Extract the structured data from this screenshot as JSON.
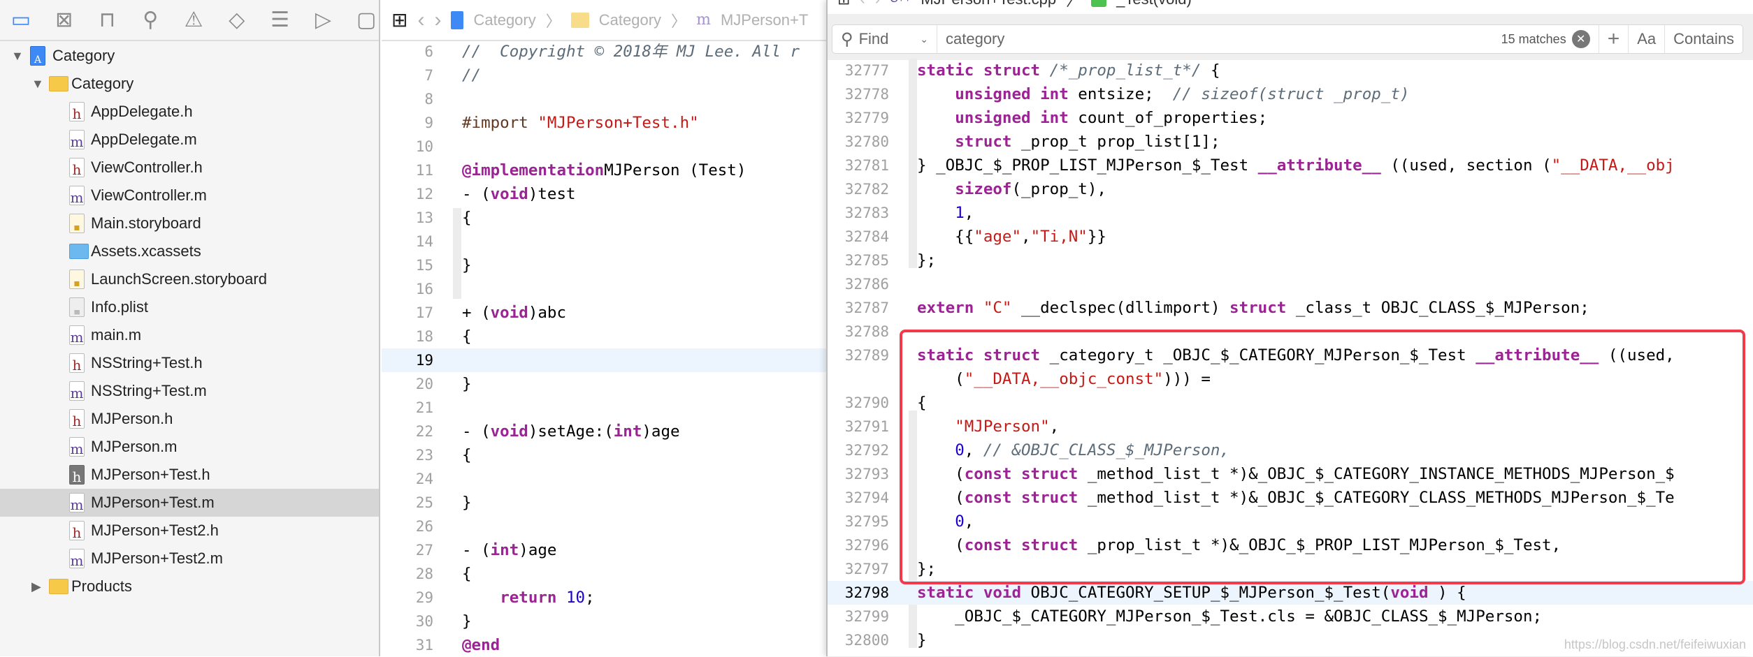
{
  "colors": {
    "accent": "#3d8af7",
    "keyword": "#9b2393",
    "string": "#c41a16",
    "comment": "#5d6c79",
    "number": "#1c00cf",
    "preprocessor": "#643820",
    "highlight_box": "#f23a4a"
  },
  "navigator_icons": [
    "folder-icon",
    "source-control-icon",
    "hierarchy-icon",
    "search-icon",
    "warning-icon",
    "test-icon",
    "debug-icon",
    "breakpoint-icon",
    "report-icon"
  ],
  "tree": [
    {
      "label": "Category",
      "icon": "project",
      "level": 0,
      "expanded": true
    },
    {
      "label": "Category",
      "icon": "folder",
      "level": 1,
      "expanded": true
    },
    {
      "label": "AppDelegate.h",
      "icon": "h",
      "level": 2
    },
    {
      "label": "AppDelegate.m",
      "icon": "m",
      "level": 2
    },
    {
      "label": "ViewController.h",
      "icon": "h",
      "level": 2
    },
    {
      "label": "ViewController.m",
      "icon": "m",
      "level": 2
    },
    {
      "label": "Main.storyboard",
      "icon": "storyboard",
      "level": 2
    },
    {
      "label": "Assets.xcassets",
      "icon": "bluefolder",
      "level": 2
    },
    {
      "label": "LaunchScreen.storyboard",
      "icon": "storyboard",
      "level": 2
    },
    {
      "label": "Info.plist",
      "icon": "plist",
      "level": 2
    },
    {
      "label": "main.m",
      "icon": "m",
      "level": 2
    },
    {
      "label": "NSString+Test.h",
      "icon": "h",
      "level": 2
    },
    {
      "label": "NSString+Test.m",
      "icon": "m",
      "level": 2
    },
    {
      "label": "MJPerson.h",
      "icon": "h",
      "level": 2
    },
    {
      "label": "MJPerson.m",
      "icon": "m",
      "level": 2
    },
    {
      "label": "MJPerson+Test.h",
      "icon": "hdark",
      "level": 2
    },
    {
      "label": "MJPerson+Test.m",
      "icon": "m",
      "level": 2,
      "selected": true
    },
    {
      "label": "MJPerson+Test2.h",
      "icon": "h",
      "level": 2
    },
    {
      "label": "MJPerson+Test2.m",
      "icon": "m",
      "level": 2
    },
    {
      "label": "Products",
      "icon": "folder",
      "level": 1,
      "expanded": false
    }
  ],
  "left_editor": {
    "breadcrumb": [
      "Category",
      "Category",
      "MJPerson+T"
    ],
    "current_line": 19,
    "lines": [
      {
        "n": "6",
        "t": [
          [
            "com",
            "//  Copyright © 2018年 MJ Lee. All r"
          ]
        ]
      },
      {
        "n": "7",
        "t": [
          [
            "com",
            "//"
          ]
        ]
      },
      {
        "n": "8",
        "t": []
      },
      {
        "n": "9",
        "t": [
          [
            "pp",
            "#import "
          ],
          [
            "str",
            "\"MJPerson+Test.h\""
          ]
        ]
      },
      {
        "n": "10",
        "t": []
      },
      {
        "n": "11",
        "t": [
          [
            "kw",
            "@implementation"
          ],
          [
            "",
            "MJPerson (Test)"
          ]
        ]
      },
      {
        "n": "12",
        "t": [
          [
            "",
            "- ("
          ],
          [
            "kw",
            "void"
          ],
          [
            "",
            ")test"
          ]
        ]
      },
      {
        "n": "13",
        "t": [
          [
            "",
            "{"
          ]
        ]
      },
      {
        "n": "14",
        "t": []
      },
      {
        "n": "15",
        "t": [
          [
            "",
            "}"
          ]
        ]
      },
      {
        "n": "16",
        "t": []
      },
      {
        "n": "17",
        "t": [
          [
            "",
            "+ ("
          ],
          [
            "kw",
            "void"
          ],
          [
            "",
            ")abc"
          ]
        ]
      },
      {
        "n": "18",
        "t": [
          [
            "",
            "{"
          ]
        ]
      },
      {
        "n": "19",
        "t": []
      },
      {
        "n": "20",
        "t": [
          [
            "",
            "}"
          ]
        ]
      },
      {
        "n": "21",
        "t": []
      },
      {
        "n": "22",
        "t": [
          [
            "",
            "- ("
          ],
          [
            "kw",
            "void"
          ],
          [
            "",
            ")setAge:("
          ],
          [
            "kw",
            "int"
          ],
          [
            "",
            ")age"
          ]
        ]
      },
      {
        "n": "23",
        "t": [
          [
            "",
            "{"
          ]
        ]
      },
      {
        "n": "24",
        "t": []
      },
      {
        "n": "25",
        "t": [
          [
            "",
            "}"
          ]
        ]
      },
      {
        "n": "26",
        "t": []
      },
      {
        "n": "27",
        "t": [
          [
            "",
            "- ("
          ],
          [
            "kw",
            "int"
          ],
          [
            "",
            ")age"
          ]
        ]
      },
      {
        "n": "28",
        "t": [
          [
            "",
            "{"
          ]
        ]
      },
      {
        "n": "29",
        "t": [
          [
            "",
            "    "
          ],
          [
            "kw",
            "return"
          ],
          [
            "num",
            " 10"
          ],
          [
            "",
            ";"
          ]
        ]
      },
      {
        "n": "30",
        "t": [
          [
            "",
            "}"
          ]
        ]
      },
      {
        "n": "31",
        "t": [
          [
            "kw",
            "@end"
          ]
        ]
      }
    ]
  },
  "right_editor": {
    "breadcrumb": [
      "MJPerson+Test.cpp",
      "_Test(void)"
    ],
    "find": {
      "mode": "Find",
      "query": "category",
      "matches": "15 matches",
      "case_label": "Aa",
      "match_type": "Contains"
    },
    "current_line": "32798",
    "lines": [
      {
        "n": "32777",
        "t": [
          [
            "kw",
            "static struct "
          ],
          [
            "com",
            "/*_prop_list_t*/"
          ],
          [
            "",
            " {"
          ]
        ]
      },
      {
        "n": "32778",
        "t": [
          [
            "",
            "    "
          ],
          [
            "kw",
            "unsigned int"
          ],
          [
            "",
            " entsize;  "
          ],
          [
            "com",
            "// sizeof(struct _prop_t)"
          ]
        ]
      },
      {
        "n": "32779",
        "t": [
          [
            "",
            "    "
          ],
          [
            "kw",
            "unsigned int"
          ],
          [
            "",
            " count_of_properties;"
          ]
        ]
      },
      {
        "n": "32780",
        "t": [
          [
            "",
            "    "
          ],
          [
            "kw",
            "struct"
          ],
          [
            "",
            " _prop_t prop_list[1];"
          ]
        ]
      },
      {
        "n": "32781",
        "t": [
          [
            "",
            "} _OBJC_$_PROP_LIST_MJPerson_$_Test "
          ],
          [
            "kw",
            "__attribute__"
          ],
          [
            "",
            " ((used, section ("
          ],
          [
            "str",
            "\"__DATA,__obj"
          ]
        ]
      },
      {
        "n": "32782",
        "t": [
          [
            "",
            "    "
          ],
          [
            "kw",
            "sizeof"
          ],
          [
            "",
            "(_prop_t),"
          ]
        ]
      },
      {
        "n": "32783",
        "t": [
          [
            "",
            "    "
          ],
          [
            "num",
            "1"
          ],
          [
            "",
            ","
          ]
        ]
      },
      {
        "n": "32784",
        "t": [
          [
            "",
            "    {{"
          ],
          [
            "str",
            "\"age\""
          ],
          [
            "",
            ","
          ],
          [
            "str",
            "\"Ti,N\""
          ],
          [
            "",
            "}}"
          ]
        ]
      },
      {
        "n": "32785",
        "t": [
          [
            "",
            "};"
          ]
        ]
      },
      {
        "n": "32786",
        "t": []
      },
      {
        "n": "32787",
        "t": [
          [
            "kw",
            "extern "
          ],
          [
            "str",
            "\"C\""
          ],
          [
            "",
            " __declspec(dllimport) "
          ],
          [
            "kw",
            "struct"
          ],
          [
            "",
            " _class_t OBJC_CLASS_$_MJPerson;"
          ]
        ]
      },
      {
        "n": "32788",
        "t": []
      },
      {
        "n": "32789",
        "t": [
          [
            "kw",
            "static struct"
          ],
          [
            "",
            " _category_t _OBJC_$_CATEGORY_MJPerson_$_Test "
          ],
          [
            "kw",
            "__attribute__"
          ],
          [
            "",
            " ((used,"
          ]
        ]
      },
      {
        "n": "",
        "t": [
          [
            "",
            "    ("
          ],
          [
            "str",
            "\"__DATA,__objc_const\""
          ],
          [
            "",
            ")))"
          ],
          [
            "",
            " ="
          ]
        ]
      },
      {
        "n": "32790",
        "t": [
          [
            "",
            "{"
          ]
        ]
      },
      {
        "n": "32791",
        "t": [
          [
            "",
            "    "
          ],
          [
            "str",
            "\"MJPerson\""
          ],
          [
            "",
            ","
          ]
        ]
      },
      {
        "n": "32792",
        "t": [
          [
            "",
            "    "
          ],
          [
            "num",
            "0"
          ],
          [
            "",
            ", "
          ],
          [
            "com",
            "// &OBJC_CLASS_$_MJPerson,"
          ]
        ]
      },
      {
        "n": "32793",
        "t": [
          [
            "",
            "    ("
          ],
          [
            "kw",
            "const struct"
          ],
          [
            "",
            " _method_list_t *)&_OBJC_$_CATEGORY_INSTANCE_METHODS_MJPerson_$"
          ]
        ]
      },
      {
        "n": "32794",
        "t": [
          [
            "",
            "    ("
          ],
          [
            "kw",
            "const struct"
          ],
          [
            "",
            " _method_list_t *)&_OBJC_$_CATEGORY_CLASS_METHODS_MJPerson_$_Te"
          ]
        ]
      },
      {
        "n": "32795",
        "t": [
          [
            "",
            "    "
          ],
          [
            "num",
            "0"
          ],
          [
            "",
            ","
          ]
        ]
      },
      {
        "n": "32796",
        "t": [
          [
            "",
            "    ("
          ],
          [
            "kw",
            "const struct"
          ],
          [
            "",
            " _prop_list_t *)&_OBJC_$_PROP_LIST_MJPerson_$_Test,"
          ]
        ]
      },
      {
        "n": "32797",
        "t": [
          [
            "",
            "};"
          ]
        ]
      },
      {
        "n": "32798",
        "t": [
          [
            "kw",
            "static void"
          ],
          [
            "",
            " OBJC_CATEGORY_SETUP_$_MJPerson_$_Test("
          ],
          [
            "kw",
            "void"
          ],
          [
            "",
            " ) {"
          ]
        ]
      },
      {
        "n": "32799",
        "t": [
          [
            "",
            "    _OBJC_$_CATEGORY_MJPerson_$_Test.cls = &OBJC_CLASS_$_MJPerson;"
          ]
        ]
      },
      {
        "n": "32800",
        "t": [
          [
            "",
            "}"
          ]
        ]
      }
    ]
  },
  "watermark": "https://blog.csdn.net/feifeiwuxian"
}
